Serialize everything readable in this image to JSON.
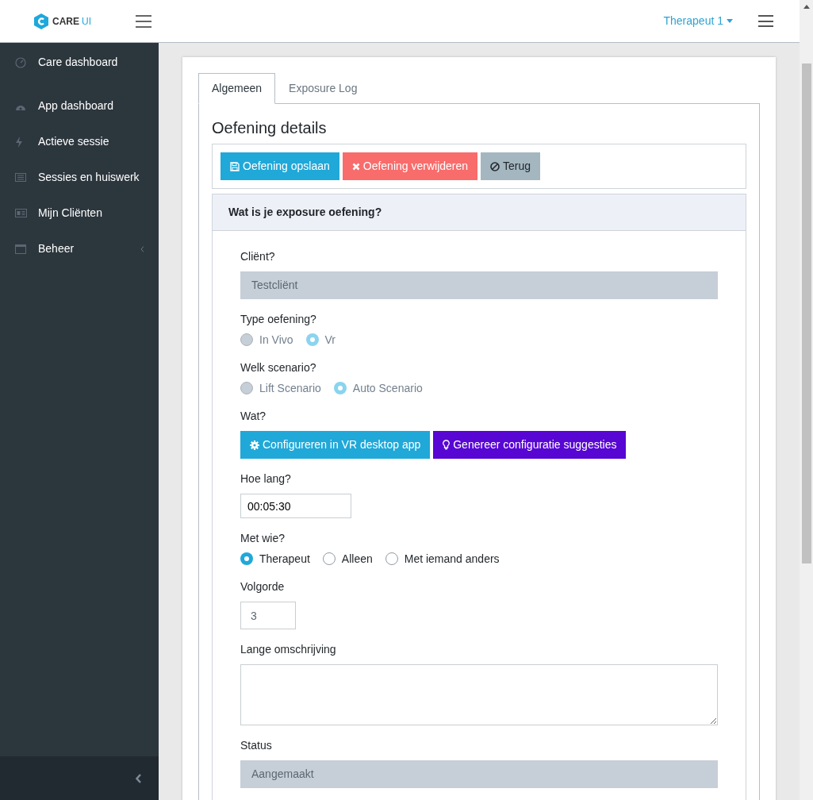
{
  "header": {
    "logo": {
      "brand": "CARE",
      "suffix": "UI"
    },
    "user_menu": "Therapeut 1"
  },
  "sidebar": {
    "items": [
      {
        "label": "Care dashboard",
        "selected": false,
        "has_submenu": false
      },
      {
        "label": "App dashboard",
        "selected": false,
        "has_submenu": false
      },
      {
        "label": "Actieve sessie",
        "selected": false,
        "has_submenu": false
      },
      {
        "label": "Sessies en huiswerk",
        "selected": false,
        "has_submenu": false
      },
      {
        "label": "Mijn Cliënten",
        "selected": false,
        "has_submenu": false
      },
      {
        "label": "Beheer",
        "selected": false,
        "has_submenu": true
      }
    ]
  },
  "tabs": [
    {
      "label": "Algemeen",
      "selected": true
    },
    {
      "label": "Exposure Log",
      "selected": false
    }
  ],
  "title": "Oefening details",
  "toolbar": [
    {
      "kind": "primary",
      "label": "Oefening opslaan"
    },
    {
      "kind": "danger",
      "label": "Oefening verwijderen"
    },
    {
      "kind": "secondary",
      "label": "Terug"
    }
  ],
  "section_title": "Wat is je exposure oefening?",
  "fields": [
    {
      "kind": "select",
      "label": "Cliënt?",
      "value": "Testcliënt",
      "disabled": true
    },
    {
      "kind": "radio",
      "label": "Type oefening?",
      "disabled": true,
      "options": [
        {
          "label": "In Vivo",
          "selected": false
        },
        {
          "label": "Vr",
          "selected": true
        }
      ]
    },
    {
      "kind": "radio",
      "label": "Welk scenario?",
      "disabled": true,
      "options": [
        {
          "label": "Lift Scenario",
          "selected": false
        },
        {
          "label": "Auto Scenario",
          "selected": true
        }
      ]
    },
    {
      "kind": "buttons",
      "label": "Wat?",
      "buttons": [
        {
          "kind": "primary",
          "label": "Configureren in VR desktop app"
        },
        {
          "kind": "purple",
          "label": "Genereer configuratie suggesties"
        }
      ]
    },
    {
      "kind": "time",
      "label": "Hoe lang?",
      "value": "00:05:30"
    },
    {
      "kind": "radio",
      "label": "Met wie?",
      "disabled": false,
      "options": [
        {
          "label": "Therapeut",
          "selected": true
        },
        {
          "label": "Alleen",
          "selected": false
        },
        {
          "label": "Met iemand anders",
          "selected": false
        }
      ]
    },
    {
      "kind": "number",
      "label": "Volgorde",
      "value": "3"
    },
    {
      "kind": "textarea",
      "label": "Lange omschrijving"
    },
    {
      "kind": "select",
      "label": "Status",
      "value": "Aangemaakt",
      "disabled": true
    }
  ]
}
